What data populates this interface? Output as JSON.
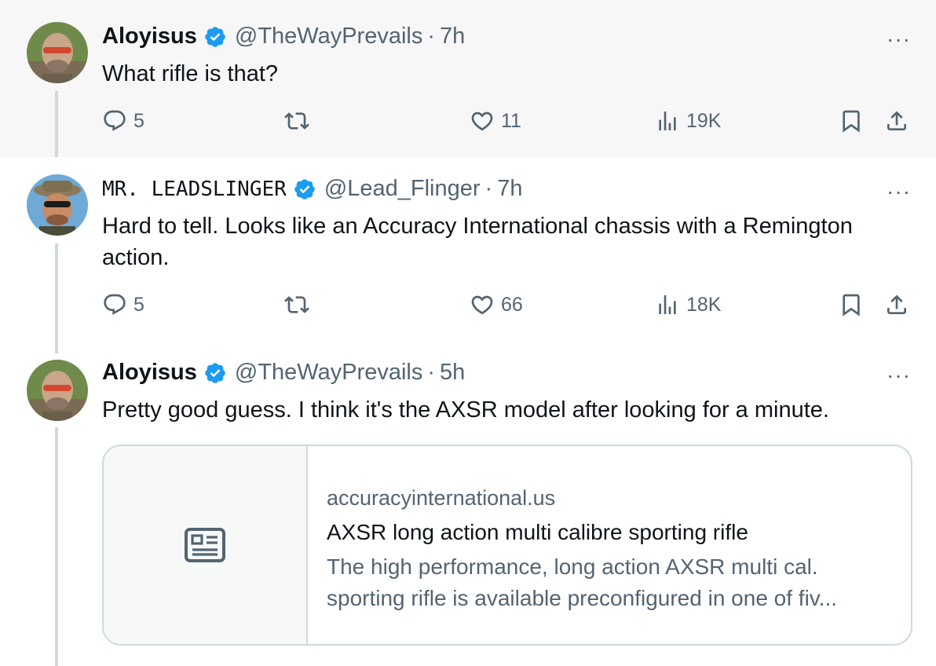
{
  "colors": {
    "accent": "#1d9bf0",
    "secondary_text": "#536471",
    "highlight_bg": "#f7f7f7",
    "border": "#cfd9de"
  },
  "tweets": [
    {
      "name": "Aloyisus",
      "handle": "@TheWayPrevails",
      "time": "7h",
      "text": "What rifle is that?",
      "replies": "5",
      "likes": "11",
      "views": "19K"
    },
    {
      "name": "MR. LEADSLINGER",
      "handle": "@Lead_Flinger",
      "time": "7h",
      "text": "Hard to tell. Looks like an Accuracy International chassis with a Remington action.",
      "replies": "5",
      "likes": "66",
      "views": "18K"
    },
    {
      "name": "Aloyisus",
      "handle": "@TheWayPrevails",
      "time": "5h",
      "text": "Pretty good guess. I think it's the AXSR model after looking for a minute.",
      "card": {
        "domain": "accuracyinternational.us",
        "title": "AXSR long action multi calibre sporting rifle",
        "description": "The high performance, long action AXSR multi cal. sporting rifle is available preconfigured in one of fiv..."
      }
    }
  ],
  "labels": {
    "separator": "·",
    "more": "···"
  },
  "icons": [
    "reply-icon",
    "retweet-icon",
    "like-icon",
    "views-icon",
    "bookmark-icon",
    "share-icon",
    "verified-badge-icon",
    "article-icon"
  ]
}
